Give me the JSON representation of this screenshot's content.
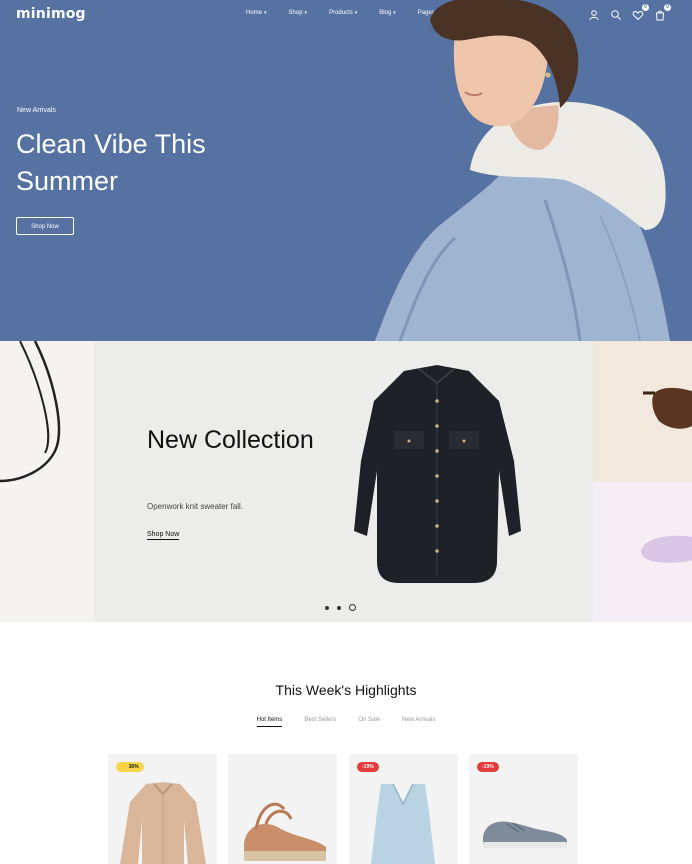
{
  "header": {
    "logo": "minimog",
    "nav": [
      {
        "label": "Home"
      },
      {
        "label": "Shop"
      },
      {
        "label": "Products"
      },
      {
        "label": "Blog"
      },
      {
        "label": "Pages"
      }
    ],
    "wishlist_count": "0",
    "cart_count": "0"
  },
  "hero": {
    "kicker": "New Arrivals",
    "title": "Clean Vibe This Summer",
    "button": "Shop Now"
  },
  "collection": {
    "title": "New Collection",
    "subtitle": "Openwork knit sweater fall.",
    "link": "Shop Now",
    "slides_total": 3,
    "active_slide": 3
  },
  "highlights": {
    "title": "This Week's Highlights",
    "tabs": [
      {
        "label": "Hot Items",
        "active": true
      },
      {
        "label": "Best Sellers",
        "active": false
      },
      {
        "label": "On Sale",
        "active": false
      },
      {
        "label": "New Arrivals",
        "active": false
      }
    ],
    "products": [
      {
        "badge": "⚡ 36%",
        "badge_type": "hot",
        "image": "jacket"
      },
      {
        "badge": "",
        "badge_type": "",
        "image": "sandal"
      },
      {
        "badge": "-19%",
        "badge_type": "sale",
        "image": "vest"
      },
      {
        "badge": "-19%",
        "badge_type": "sale",
        "image": "sneaker"
      }
    ]
  },
  "colors": {
    "hero_bg": "#5572a2",
    "banner_bg": "#ececea",
    "sale_badge": "#e43b3b",
    "hot_badge": "#f6d54b"
  }
}
